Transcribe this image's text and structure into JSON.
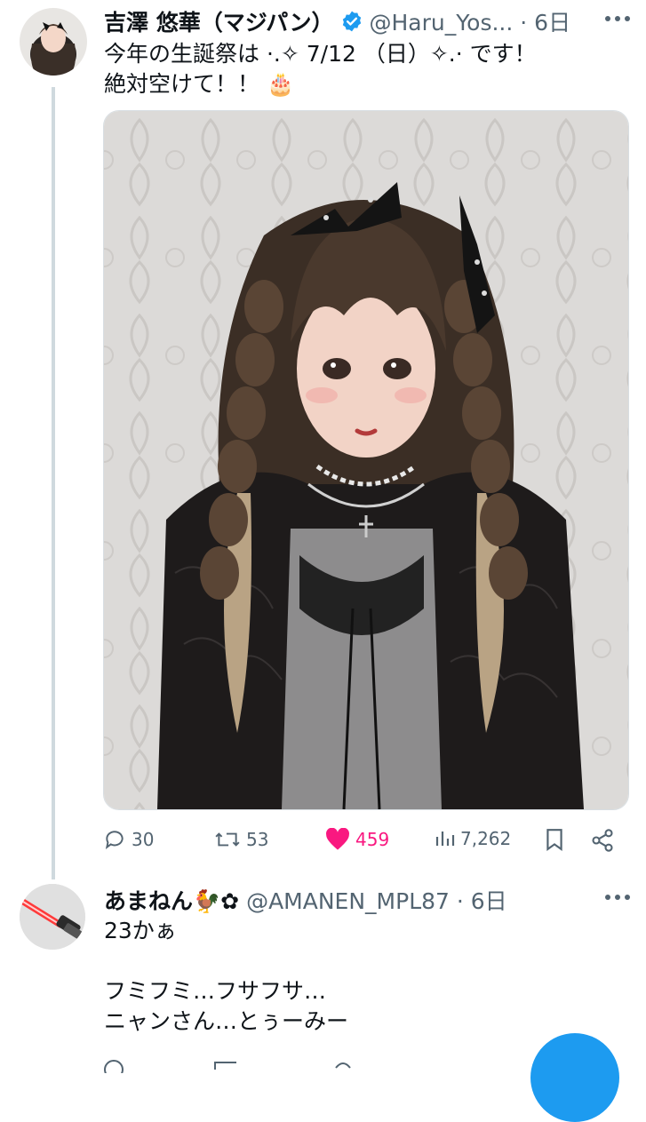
{
  "tweet": {
    "display_name": "吉澤 悠華（マジパン）",
    "handle_time": "@Haru_Yos... · 6日",
    "text": "今年の生誕祭は ·.✧ 7/12 （日）✧.· です！\n絶対空けて！！ 🎂",
    "avatar_icon": "profile-photo-avatar",
    "verified_icon": "verified-badge-icon",
    "stats": {
      "replies": "30",
      "retweets": "53",
      "likes": "459",
      "views": "7,262"
    }
  },
  "reply": {
    "display_name": "あまねん🐓✿",
    "handle_time": "@AMANEN_MPL87 · 6日",
    "text": "23かぁ\n\nフミフミ…フサフサ…\nニャンさん…とぅーみー",
    "avatar_icon": "lightsaber-avatar"
  },
  "colors": {
    "accent": "#1d9bf0",
    "like": "#f91880",
    "muted": "#536471",
    "thread_line": "#cfd9de"
  }
}
